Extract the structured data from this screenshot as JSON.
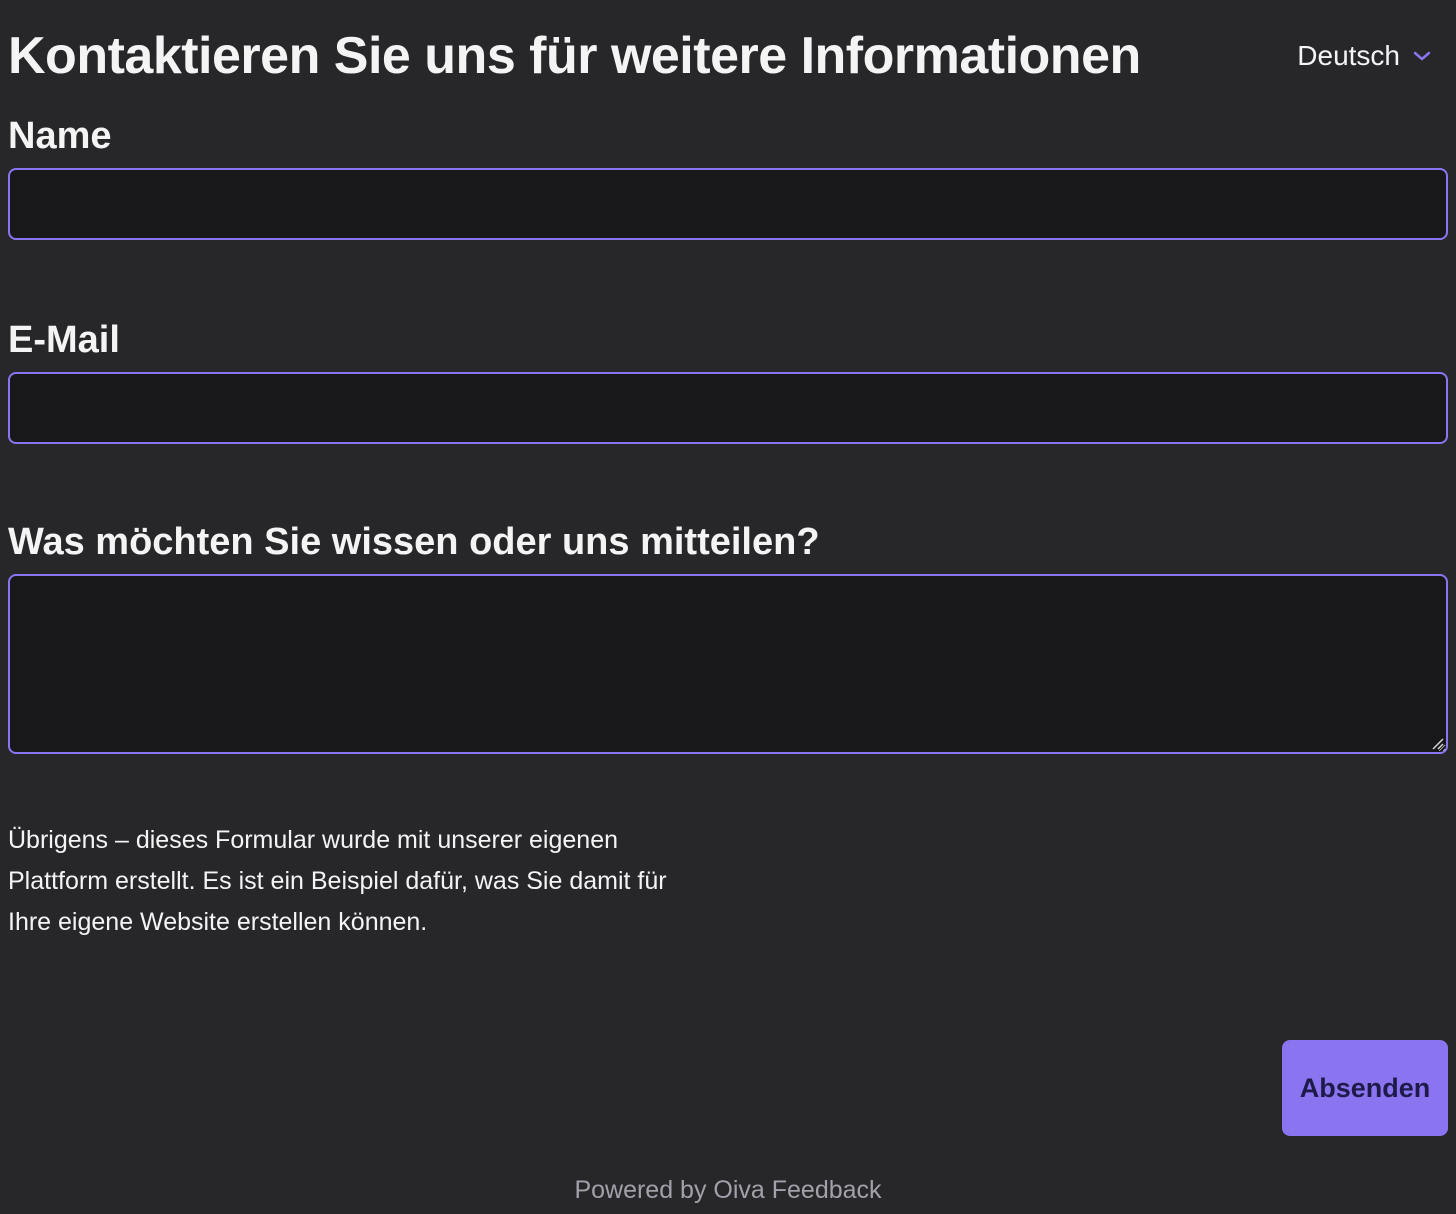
{
  "header": {
    "title": "Kontaktieren Sie uns für weitere Informationen",
    "language_select": {
      "selected": "Deutsch",
      "icon": "chevron-down-icon"
    }
  },
  "form": {
    "name_field": {
      "label": "Name",
      "value": ""
    },
    "email_field": {
      "label": "E-Mail",
      "value": ""
    },
    "message_field": {
      "label": "Was möchten Sie wissen oder uns mitteilen?",
      "value": ""
    },
    "info_text": "Übrigens – dieses Formular wurde mit unserer eigenen Plattform erstellt. Es ist ein Beispiel dafür, was Sie damit für Ihre eigene Website erstellen können.",
    "submit_label": "Absenden"
  },
  "footer": {
    "text": "Powered by Oiva Feedback"
  },
  "colors": {
    "background": "#27272a",
    "input_background": "#18181b",
    "accent": "#8b74f0",
    "button_text": "#1e1b4b",
    "footer_text": "#a1a1aa"
  }
}
